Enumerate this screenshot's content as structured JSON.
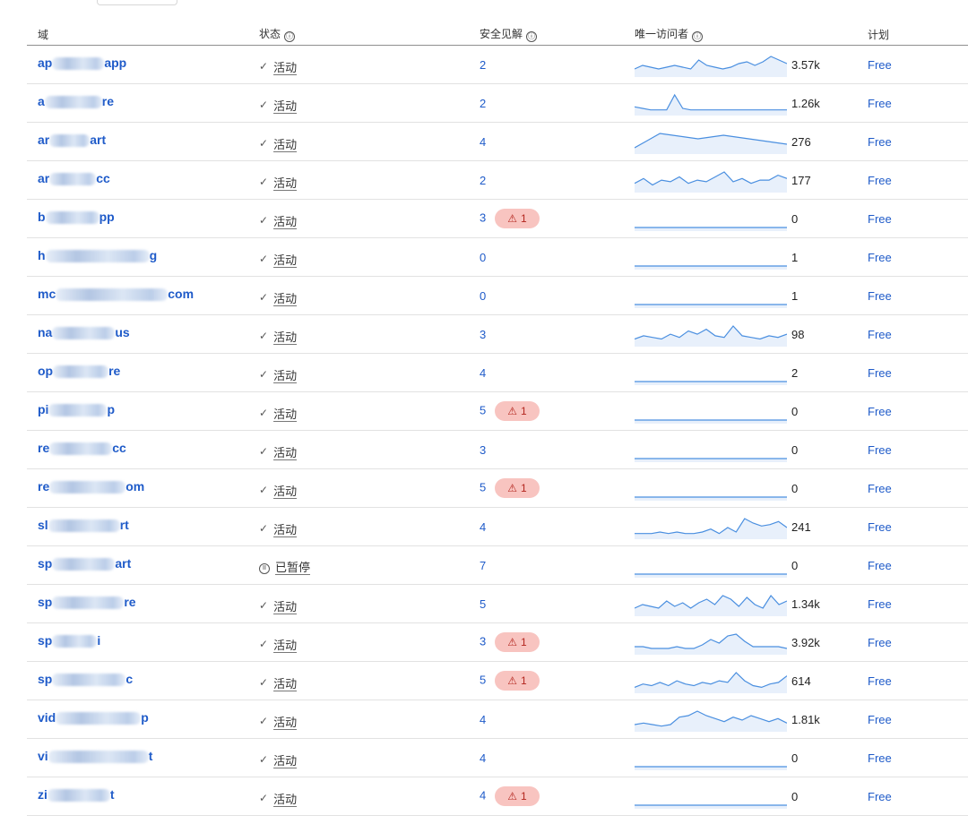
{
  "headers": {
    "domain": "域",
    "status": "状态",
    "insights": "安全见解",
    "visitors": "唯一访问者",
    "plan": "计划"
  },
  "info_icon": "ⓘ",
  "check_icon": "✓",
  "pause_icon": "II",
  "warn_icon": "⚠",
  "colors": {
    "link": "#1f5bc9",
    "badge_bg": "#f8c4c0",
    "badge_text": "#b3261e",
    "spark": "#4a8fe0"
  },
  "rows": [
    {
      "prefix": "ap",
      "suffix": "app",
      "blur": 58,
      "status": "活动",
      "paused": false,
      "insights": "2",
      "alert": "",
      "visitors": "3.57k",
      "plan": "Free",
      "spark": [
        3,
        5,
        4,
        3,
        4,
        5,
        4,
        3,
        8,
        5,
        4,
        3,
        4,
        6,
        7,
        5,
        7,
        10,
        8,
        6
      ]
    },
    {
      "prefix": "a",
      "suffix": "re",
      "blur": 64,
      "status": "活动",
      "paused": false,
      "insights": "2",
      "alert": "",
      "visitors": "1.26k",
      "plan": "Free",
      "spark": [
        4,
        3,
        2,
        2,
        2,
        12,
        3,
        2,
        2,
        2,
        2,
        2,
        2,
        2,
        2,
        2,
        2,
        2,
        2,
        2
      ]
    },
    {
      "prefix": "ar",
      "suffix": "art",
      "blur": 45,
      "status": "活动",
      "paused": false,
      "insights": "4",
      "alert": "",
      "visitors": "276",
      "plan": "Free",
      "spark": [
        2,
        6,
        10,
        9,
        8,
        7,
        8,
        9,
        8,
        7,
        6,
        5,
        4
      ]
    },
    {
      "prefix": "ar",
      "suffix": "cc",
      "blur": 52,
      "status": "活动",
      "paused": false,
      "insights": "2",
      "alert": "",
      "visitors": "177",
      "plan": "Free",
      "spark": [
        4,
        7,
        3,
        6,
        5,
        8,
        4,
        6,
        5,
        8,
        11,
        5,
        7,
        4,
        6,
        6,
        9,
        7
      ]
    },
    {
      "prefix": "b",
      "suffix": "pp",
      "blur": 60,
      "status": "活动",
      "paused": false,
      "insights": "3",
      "alert": "1",
      "visitors": "0",
      "plan": "Free",
      "spark": [
        0,
        0,
        0,
        0,
        0,
        0,
        0,
        0,
        0,
        0
      ]
    },
    {
      "prefix": "h",
      "suffix": "g",
      "blur": 116,
      "status": "活动",
      "paused": false,
      "insights": "0",
      "alert": "",
      "visitors": "1",
      "plan": "Free",
      "spark": [
        0,
        0,
        0,
        0,
        0,
        0,
        0,
        0,
        0,
        0
      ]
    },
    {
      "prefix": "mc",
      "suffix": "com",
      "blur": 125,
      "status": "活动",
      "paused": false,
      "insights": "0",
      "alert": "",
      "visitors": "1",
      "plan": "Free",
      "spark": [
        0,
        0,
        0,
        0,
        0,
        0,
        0,
        0,
        0,
        0
      ]
    },
    {
      "prefix": "na",
      "suffix": "us",
      "blur": 70,
      "status": "活动",
      "paused": false,
      "insights": "3",
      "alert": "",
      "visitors": "98",
      "plan": "Free",
      "spark": [
        3,
        5,
        4,
        3,
        6,
        4,
        8,
        6,
        9,
        5,
        4,
        11,
        5,
        4,
        3,
        5,
        4,
        6
      ]
    },
    {
      "prefix": "op",
      "suffix": "re",
      "blur": 62,
      "status": "活动",
      "paused": false,
      "insights": "4",
      "alert": "",
      "visitors": "2",
      "plan": "Free",
      "spark": [
        0,
        0,
        0,
        0,
        0,
        0,
        0,
        0,
        0,
        0
      ]
    },
    {
      "prefix": "pi",
      "suffix": "p",
      "blur": 65,
      "status": "活动",
      "paused": false,
      "insights": "5",
      "alert": "1",
      "visitors": "0",
      "plan": "Free",
      "spark": [
        0,
        0,
        0,
        0,
        0,
        0,
        0,
        0,
        0,
        0
      ]
    },
    {
      "prefix": "re",
      "suffix": "cc",
      "blur": 70,
      "status": "活动",
      "paused": false,
      "insights": "3",
      "alert": "",
      "visitors": "0",
      "plan": "Free",
      "spark": [
        0,
        0,
        0,
        0,
        0,
        0,
        0,
        0,
        0,
        0
      ]
    },
    {
      "prefix": "re",
      "suffix": "om",
      "blur": 85,
      "status": "活动",
      "paused": false,
      "insights": "5",
      "alert": "1",
      "visitors": "0",
      "plan": "Free",
      "spark": [
        0,
        0,
        0,
        0,
        0,
        0,
        0,
        0,
        0,
        0
      ]
    },
    {
      "prefix": "sl",
      "suffix": "rt",
      "blur": 80,
      "status": "活动",
      "paused": false,
      "insights": "4",
      "alert": "",
      "visitors": "241",
      "plan": "Free",
      "spark": [
        2,
        2,
        2,
        3,
        2,
        3,
        2,
        2,
        3,
        5,
        2,
        6,
        3,
        12,
        9,
        7,
        8,
        10,
        6
      ]
    },
    {
      "prefix": "sp",
      "suffix": "art",
      "blur": 70,
      "status": "已暂停",
      "paused": true,
      "insights": "7",
      "alert": "",
      "visitors": "0",
      "plan": "Free",
      "spark": [
        0,
        0,
        0,
        0,
        0,
        0,
        0,
        0,
        0,
        0
      ]
    },
    {
      "prefix": "sp",
      "suffix": "re",
      "blur": 80,
      "status": "活动",
      "paused": false,
      "insights": "5",
      "alert": "",
      "visitors": "1.34k",
      "plan": "Free",
      "spark": [
        3,
        5,
        4,
        3,
        7,
        4,
        6,
        3,
        6,
        8,
        5,
        10,
        8,
        4,
        9,
        5,
        3,
        10,
        5,
        7
      ]
    },
    {
      "prefix": "sp",
      "suffix": "i",
      "blur": 50,
      "status": "活动",
      "paused": false,
      "insights": "3",
      "alert": "1",
      "visitors": "3.92k",
      "plan": "Free",
      "spark": [
        3,
        3,
        2,
        2,
        2,
        3,
        2,
        2,
        4,
        7,
        5,
        9,
        10,
        6,
        3,
        3,
        3,
        3,
        2
      ]
    },
    {
      "prefix": "sp",
      "suffix": "c",
      "blur": 82,
      "status": "活动",
      "paused": false,
      "insights": "5",
      "alert": "1",
      "visitors": "614",
      "plan": "Free",
      "spark": [
        2,
        4,
        3,
        5,
        3,
        6,
        4,
        3,
        5,
        4,
        6,
        5,
        11,
        6,
        3,
        2,
        4,
        5,
        9
      ]
    },
    {
      "prefix": "vid",
      "suffix": "p",
      "blur": 95,
      "status": "活动",
      "paused": false,
      "insights": "4",
      "alert": "",
      "visitors": "1.81k",
      "plan": "Free",
      "spark": [
        3,
        4,
        3,
        2,
        3,
        8,
        9,
        12,
        9,
        7,
        5,
        8,
        6,
        9,
        7,
        5,
        7,
        4
      ]
    },
    {
      "prefix": "vi",
      "suffix": "t",
      "blur": 112,
      "status": "活动",
      "paused": false,
      "insights": "4",
      "alert": "",
      "visitors": "0",
      "plan": "Free",
      "spark": [
        0,
        0,
        0,
        0,
        0,
        0,
        0,
        0,
        0,
        0
      ]
    },
    {
      "prefix": "zi",
      "suffix": "t",
      "blur": 70,
      "status": "活动",
      "paused": false,
      "insights": "4",
      "alert": "1",
      "visitors": "0",
      "plan": "Free",
      "spark": [
        0,
        0,
        0,
        0,
        0,
        0,
        0,
        0,
        0,
        0
      ]
    }
  ]
}
